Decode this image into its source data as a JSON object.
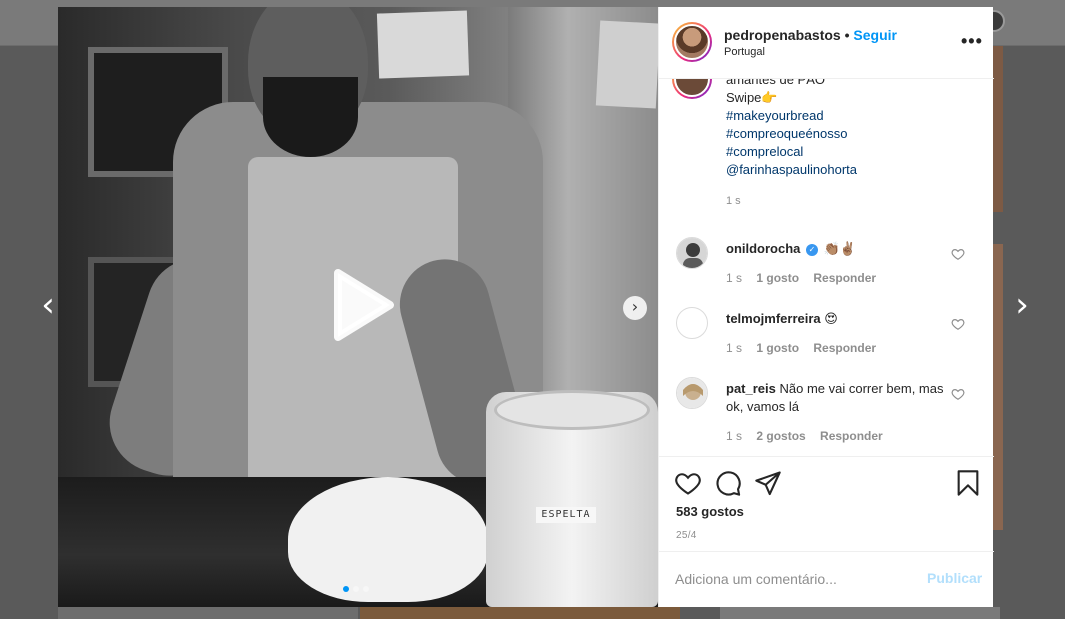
{
  "header": {
    "username": "pedropenabastos",
    "separator": "•",
    "follow_label": "Seguir",
    "location": "Portugal",
    "more_icon": "ellipsis-icon"
  },
  "caption": {
    "lines": [
      {
        "text": "amantes de PÃO",
        "type": "plain"
      },
      {
        "text": "Swipe👉",
        "type": "plain"
      },
      {
        "text": "#makeyourbread",
        "type": "tag"
      },
      {
        "text": "#compreoqueénosso",
        "type": "tag"
      },
      {
        "text": "#comprelocal",
        "type": "tag"
      },
      {
        "text": "@farinhaspaulinohorta",
        "type": "tag"
      }
    ],
    "time": "1 s"
  },
  "comments": [
    {
      "username": "onildorocha",
      "verified": true,
      "text": "👏🏽✌🏽",
      "time": "1 s",
      "likes": "1 gosto",
      "reply": "Responder"
    },
    {
      "username": "telmojmferreira",
      "verified": false,
      "text": "😍",
      "time": "1 s",
      "likes": "1 gosto",
      "reply": "Responder"
    },
    {
      "username": "pat_reis",
      "verified": false,
      "text": "Não me vai correr bem, mas ok, vamos lá",
      "time": "1 s",
      "likes": "2 gostos",
      "reply": "Responder"
    }
  ],
  "actions": {
    "icons": [
      "heart-icon",
      "comment-icon",
      "share-icon",
      "bookmark-icon"
    ],
    "likes_count": "583 gostos",
    "date": "25/4"
  },
  "add_comment": {
    "placeholder": "Adiciona um comentário...",
    "publish_label": "Publicar"
  },
  "media": {
    "jar_label": "ESPELTA",
    "carousel_dots": 3,
    "active_dot": 0
  },
  "colors": {
    "accent": "#0095f6",
    "link": "#00376b",
    "muted": "#8e8e8e",
    "publish_disabled": "#b2dffc"
  }
}
